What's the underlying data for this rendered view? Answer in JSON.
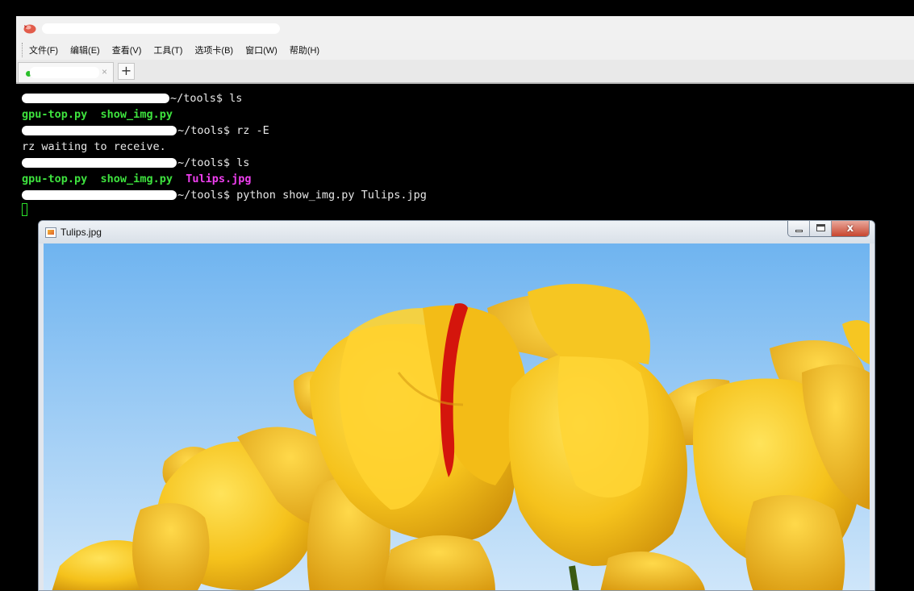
{
  "menu": {
    "items": [
      "文件(F)",
      "编辑(E)",
      "查看(V)",
      "工具(T)",
      "选项卡(B)",
      "窗口(W)",
      "帮助(H)"
    ]
  },
  "tabs": {
    "close_glyph": "×",
    "add_glyph": "+"
  },
  "terminal": {
    "prompt_suffix": "~/tools$",
    "lines": [
      {
        "command": "ls"
      },
      {
        "files": [
          "gpu-top.py",
          "show_img.py"
        ]
      },
      {
        "command": "rz -E"
      },
      {
        "output": "rz waiting to receive."
      },
      {
        "command": "ls"
      },
      {
        "files": [
          "gpu-top.py",
          "show_img.py",
          "Tulips.jpg"
        ]
      },
      {
        "command": "python show_img.py Tulips.jpg"
      }
    ],
    "colors": {
      "executable": "#3ee23e",
      "image": "#f03ff0",
      "text": "#e8e8e8"
    }
  },
  "viewer": {
    "title": "Tulips.jpg",
    "icon": "image-file-icon",
    "close_glyph": "x"
  }
}
